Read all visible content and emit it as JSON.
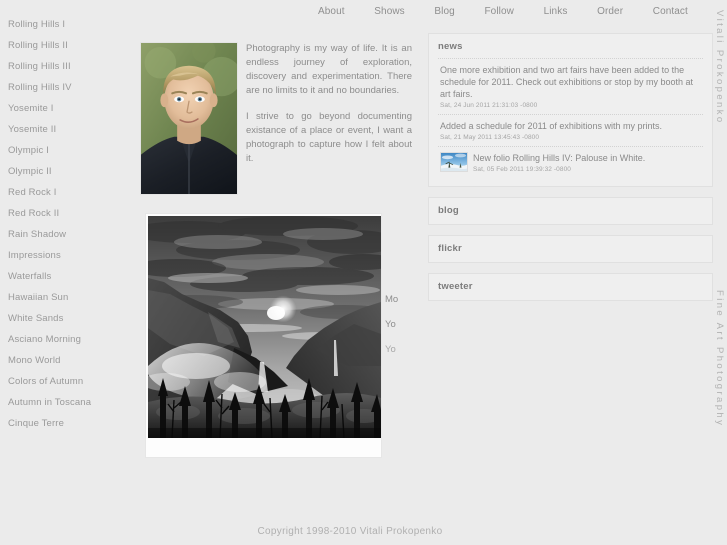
{
  "nav": {
    "items": [
      {
        "label": "About"
      },
      {
        "label": "Shows"
      },
      {
        "label": "Blog"
      },
      {
        "label": "Follow"
      },
      {
        "label": "Links"
      },
      {
        "label": "Order"
      },
      {
        "label": "Contact"
      }
    ]
  },
  "sidebar": {
    "items": [
      {
        "label": "Rolling Hills I"
      },
      {
        "label": "Rolling Hills II"
      },
      {
        "label": "Rolling Hills III"
      },
      {
        "label": "Rolling Hills IV"
      },
      {
        "label": "Yosemite I"
      },
      {
        "label": "Yosemite II"
      },
      {
        "label": "Olympic I"
      },
      {
        "label": "Olympic II"
      },
      {
        "label": "Red Rock I"
      },
      {
        "label": "Red Rock II"
      },
      {
        "label": "Rain Shadow"
      },
      {
        "label": "Impressions"
      },
      {
        "label": "Waterfalls"
      },
      {
        "label": "Hawaiian Sun"
      },
      {
        "label": "White Sands"
      },
      {
        "label": "Asciano Morning"
      },
      {
        "label": "Mono World"
      },
      {
        "label": "Colors of Autumn"
      },
      {
        "label": "Autumn in Toscana"
      },
      {
        "label": "Cinque Terre"
      }
    ]
  },
  "intro": {
    "paragraph1": "Photography is my way of life. It is an endless journey of exploration, discovery and experimentation. There are no limits to it and no boundaries.",
    "paragraph2": "I strive to go beyond documenting existance of a place or event, I want a photograph to capture how I felt about it.",
    "portrait_alt": "portrait-photo"
  },
  "photo": {
    "alt": "black-and-white-yosemite-valley-photograph"
  },
  "clipped_caption": {
    "line1": "Mo",
    "line2": "Yo",
    "line3": "Yo"
  },
  "panels": {
    "news": {
      "title": "news",
      "items": [
        {
          "headline": "One more exhibition and two art fairs have been added to the schedule for 2011. Check out exhibitions or stop by my booth at art fairs.",
          "date": "Sat, 24 Jun 2011 21:31:03 -0800",
          "has_thumb": false
        },
        {
          "headline": "Added a schedule for 2011 of exhibitions with my prints.",
          "date": "Sat, 21 May 2011 13:45:43 -0800",
          "has_thumb": false
        },
        {
          "headline": "New folio Rolling Hills IV: Palouse in White.",
          "date": "Sat, 05 Feb 2011 19:39:32 -0800",
          "has_thumb": true
        }
      ]
    },
    "blog": {
      "title": "blog"
    },
    "flickr": {
      "title": "flickr"
    },
    "tweeter": {
      "title": "tweeter"
    }
  },
  "branding": {
    "name": "Vitali Prokopenko",
    "tagline": "Fine Art Photography"
  },
  "footer": {
    "copyright": "Copyright 1998-2010 Vitali Prokopenko"
  },
  "colors": {
    "page_background": "#ebebeb",
    "panel_background": "#efefef",
    "panel_border": "#e0e0e0",
    "text": "#8a8a8a",
    "muted_text": "#b0b0b0"
  }
}
